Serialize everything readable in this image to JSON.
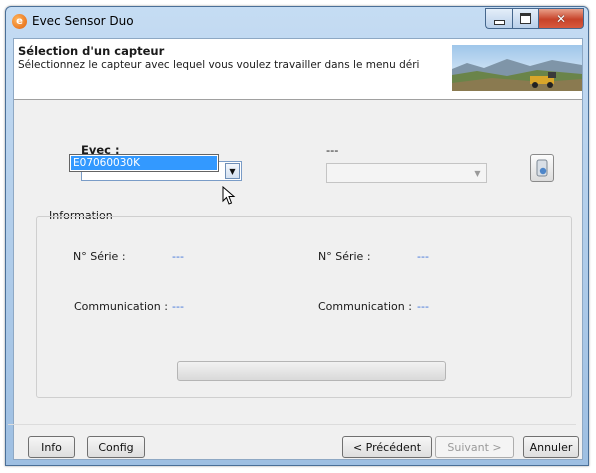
{
  "window": {
    "title": "Evec Sensor Duo",
    "app_icon_letter": "e"
  },
  "header": {
    "title": "Sélection d'un capteur",
    "subtitle": "Sélectionnez le capteur avec lequel vous voulez travailler dans le menu déri",
    "image": "landscape-banner"
  },
  "sensor1": {
    "label": "Evec :",
    "value": "",
    "dropdown_items": [
      "E07060030K"
    ]
  },
  "sensor2": {
    "label": "---",
    "value": ""
  },
  "refresh_icon": "refresh-icon",
  "information": {
    "label": "Information",
    "serial_label": "N° Série :",
    "communication_label": "Communication :",
    "left": {
      "serial": "---",
      "communication": "---"
    },
    "right": {
      "serial": "---",
      "communication": "---"
    }
  },
  "buttons": {
    "info": "Info",
    "config": "Config",
    "previous": "< Précédent",
    "next": "Suivant >",
    "cancel": "Annuler"
  }
}
